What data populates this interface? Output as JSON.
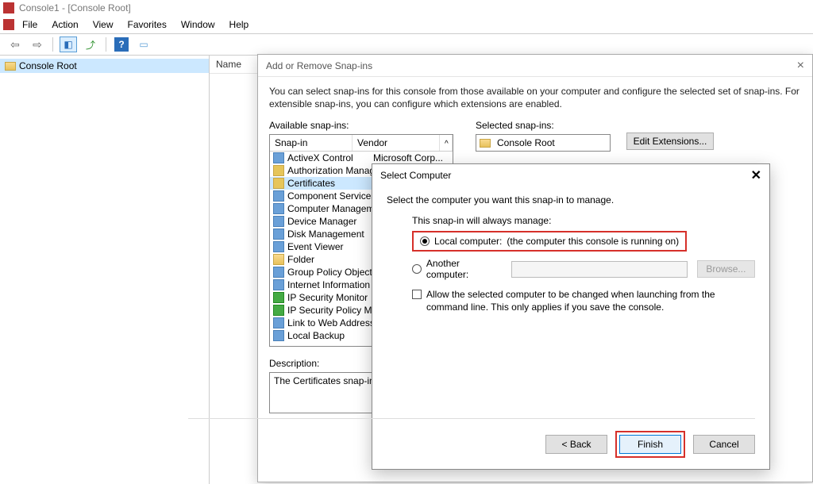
{
  "titlebar": {
    "text": "Console1 - [Console Root]"
  },
  "menubar": {
    "items": [
      "File",
      "Action",
      "View",
      "Favorites",
      "Window",
      "Help"
    ]
  },
  "tree": {
    "root": "Console Root"
  },
  "list": {
    "header": "Name"
  },
  "dialog_add": {
    "title": "Add or Remove Snap-ins",
    "intro": "You can select snap-ins for this console from those available on your computer and configure the selected set of snap-ins. For extensible snap-ins, you can configure which extensions are enabled.",
    "avail_label": "Available snap-ins:",
    "col_snapin": "Snap-in",
    "col_vendor": "Vendor",
    "vendor_ms": "Microsoft Corp...",
    "items": [
      "ActiveX Control",
      "Authorization Manager",
      "Certificates",
      "Component Services",
      "Computer Managem...",
      "Device Manager",
      "Disk Management",
      "Event Viewer",
      "Folder",
      "Group Policy Object ...",
      "Internet Information ...",
      "IP Security Monitor",
      "IP Security Policy Ma...",
      "Link to Web Address",
      "Local Backup"
    ],
    "selected_index": 2,
    "sel_label": "Selected snap-ins:",
    "sel_root": "Console Root",
    "edit_ext": "Edit Extensions...",
    "desc_label": "Description:",
    "desc_text": "The Certificates snap-in allo"
  },
  "dialog_select": {
    "title": "Select Computer",
    "intro": "Select the computer you want this snap-in to manage.",
    "group_label": "This snap-in will always manage:",
    "local_label": "Local computer:",
    "local_hint": "(the computer this console is running on)",
    "another_label": "Another computer:",
    "browse": "Browse...",
    "allow_text": "Allow the selected computer to be changed when launching from the command line.  This only applies if you save the console.",
    "back": "< Back",
    "finish": "Finish",
    "cancel": "Cancel"
  }
}
